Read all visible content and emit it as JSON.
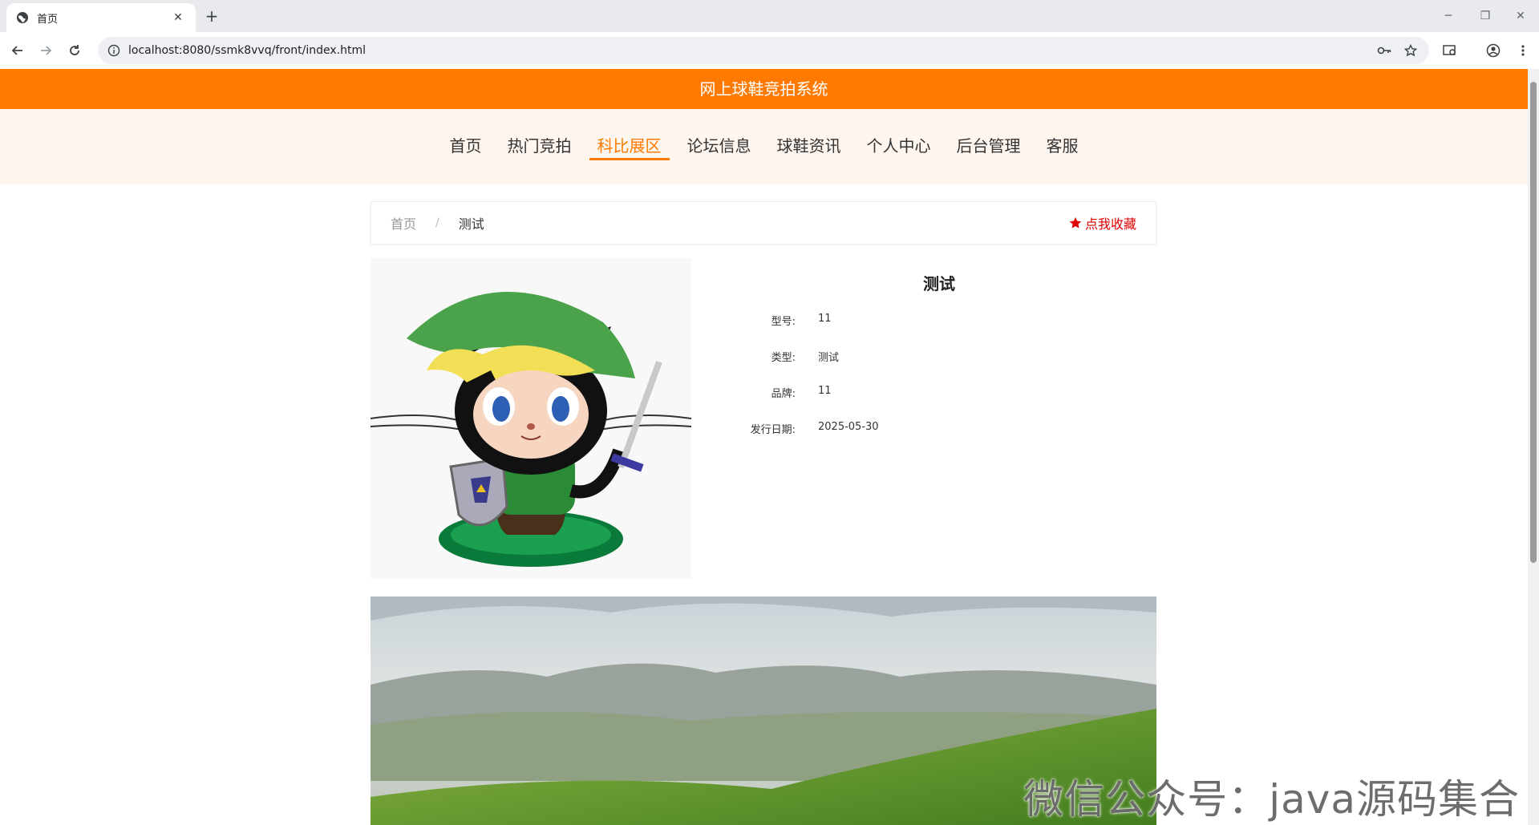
{
  "browser": {
    "tab_title": "首页",
    "tab_close": "✕",
    "new_tab": "+",
    "url": "localhost:8080/ssmk8vvq/front/index.html",
    "minimize": "─",
    "restore": "❐",
    "close": "✕"
  },
  "site": {
    "title": "网上球鞋竞拍系统",
    "accent_color": "#ff7a00"
  },
  "menu": {
    "items": [
      {
        "label": "首页"
      },
      {
        "label": "热门竞拍"
      },
      {
        "label": "科比展区"
      },
      {
        "label": "论坛信息"
      },
      {
        "label": "球鞋资讯"
      },
      {
        "label": "个人中心"
      },
      {
        "label": "后台管理"
      },
      {
        "label": "客服"
      }
    ],
    "active_index": 2
  },
  "breadcrumb": {
    "home": "首页",
    "separator": "/",
    "current": "测试",
    "favorite_label": "点我收藏"
  },
  "product": {
    "title": "测试",
    "attributes": [
      {
        "label": "型号:",
        "value": "11"
      },
      {
        "label": "类型:",
        "value": "测试"
      },
      {
        "label": "品牌:",
        "value": "11"
      },
      {
        "label": "发行日期:",
        "value": "2025-05-30"
      }
    ]
  },
  "watermark": "微信公众号：java源码集合"
}
